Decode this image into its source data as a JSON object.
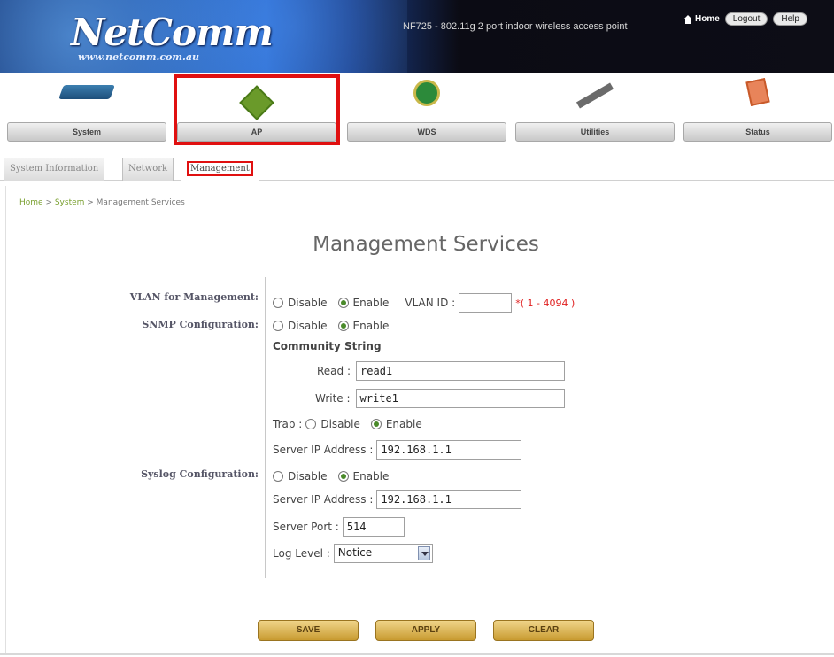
{
  "header": {
    "logo": "NetComm",
    "logo_url": "www.netcomm.com.au",
    "model_text": "NF725 - 802.11g 2 port indoor wireless access point",
    "home_label": "Home",
    "logout_label": "Logout",
    "help_label": "Help"
  },
  "nav": {
    "items": [
      {
        "label": "System",
        "icon": "router-icon"
      },
      {
        "label": "AP",
        "icon": "access-point-icon"
      },
      {
        "label": "WDS",
        "icon": "wds-icon"
      },
      {
        "label": "Utilities",
        "icon": "hammer-icon"
      },
      {
        "label": "Status",
        "icon": "status-icon"
      }
    ],
    "active": "AP"
  },
  "tabs": [
    {
      "label": "System Information"
    },
    {
      "label": "Network"
    },
    {
      "label": "Management"
    }
  ],
  "breadcrumb": {
    "home": "Home",
    "sep1": " > ",
    "system": "System",
    "sep2": " > ",
    "current": "Management Services"
  },
  "page_title": "Management Services",
  "form": {
    "vlan": {
      "label": "VLAN for Management:",
      "disable": "Disable",
      "enable": "Enable",
      "selected": "Enable",
      "vlan_id_label": "VLAN ID :",
      "vlan_id_value": "",
      "range_hint": "*( 1 - 4094 )"
    },
    "snmp": {
      "label": "SNMP Configuration:",
      "disable": "Disable",
      "enable": "Enable",
      "selected": "Enable",
      "community_heading": "Community String",
      "read_label": "Read :",
      "read_value": "read1",
      "write_label": "Write :",
      "write_value": "write1",
      "trap_label": "Trap :",
      "trap_disable": "Disable",
      "trap_enable": "Enable",
      "trap_selected": "Enable",
      "server_ip_label": "Server IP Address :",
      "server_ip_value": "192.168.1.1"
    },
    "syslog": {
      "label": "Syslog Configuration:",
      "disable": "Disable",
      "enable": "Enable",
      "selected": "Enable",
      "server_ip_label": "Server IP Address :",
      "server_ip_value": "192.168.1.1",
      "server_port_label": "Server Port :",
      "server_port_value": "514",
      "log_level_label": "Log Level :",
      "log_level_value": "Notice"
    }
  },
  "buttons": {
    "save": "SAVE",
    "apply": "APPLY",
    "clear": "CLEAR"
  },
  "colors": {
    "highlight": "#e01010",
    "button_gold": "#c89a30",
    "breadcrumb_link": "#7aa030",
    "hint_red": "#e02020"
  }
}
